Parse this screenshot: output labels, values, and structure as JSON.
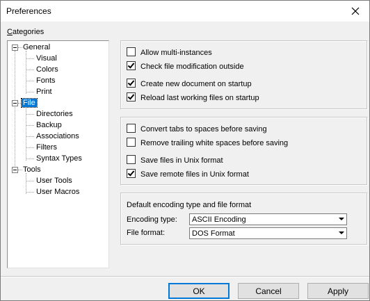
{
  "window": {
    "title": "Preferences"
  },
  "categories": {
    "label_first": "C",
    "label_rest": "ategories",
    "tree": [
      {
        "label": "General",
        "level": 0,
        "expanded": true
      },
      {
        "label": "Visual",
        "level": 1
      },
      {
        "label": "Colors",
        "level": 1
      },
      {
        "label": "Fonts",
        "level": 1
      },
      {
        "label": "Print",
        "level": 1
      },
      {
        "label": "File",
        "level": 0,
        "expanded": true,
        "selected": true
      },
      {
        "label": "Directories",
        "level": 1
      },
      {
        "label": "Backup",
        "level": 1
      },
      {
        "label": "Associations",
        "level": 1
      },
      {
        "label": "Filters",
        "level": 1
      },
      {
        "label": "Syntax Types",
        "level": 1
      },
      {
        "label": "Tools",
        "level": 0,
        "expanded": true
      },
      {
        "label": "User Tools",
        "level": 1
      },
      {
        "label": "User Macros",
        "level": 1
      }
    ]
  },
  "options": {
    "group1": [
      {
        "label": "Allow multi-instances",
        "checked": false
      },
      {
        "label": "Check file modification outside",
        "checked": true
      },
      {
        "label": "Create new document on startup",
        "checked": true
      },
      {
        "label": "Reload last working files on startup",
        "checked": true
      }
    ],
    "group2": [
      {
        "label": "Convert tabs to spaces before saving",
        "checked": false
      },
      {
        "label": "Remove trailing white spaces before saving",
        "checked": false
      },
      {
        "label": "Save files in Unix format",
        "checked": false
      },
      {
        "label": "Save remote files in Unix format",
        "checked": true
      }
    ]
  },
  "encoding": {
    "heading": "Default encoding type and file format",
    "encoding_label": "Encoding type:",
    "encoding_value": "ASCII Encoding",
    "format_label": "File format:",
    "format_value": "DOS Format"
  },
  "buttons": {
    "ok": "OK",
    "cancel": "Cancel",
    "apply": "Apply"
  },
  "colors": {
    "selection": "#0078d7",
    "face": "#f0f0f0"
  }
}
